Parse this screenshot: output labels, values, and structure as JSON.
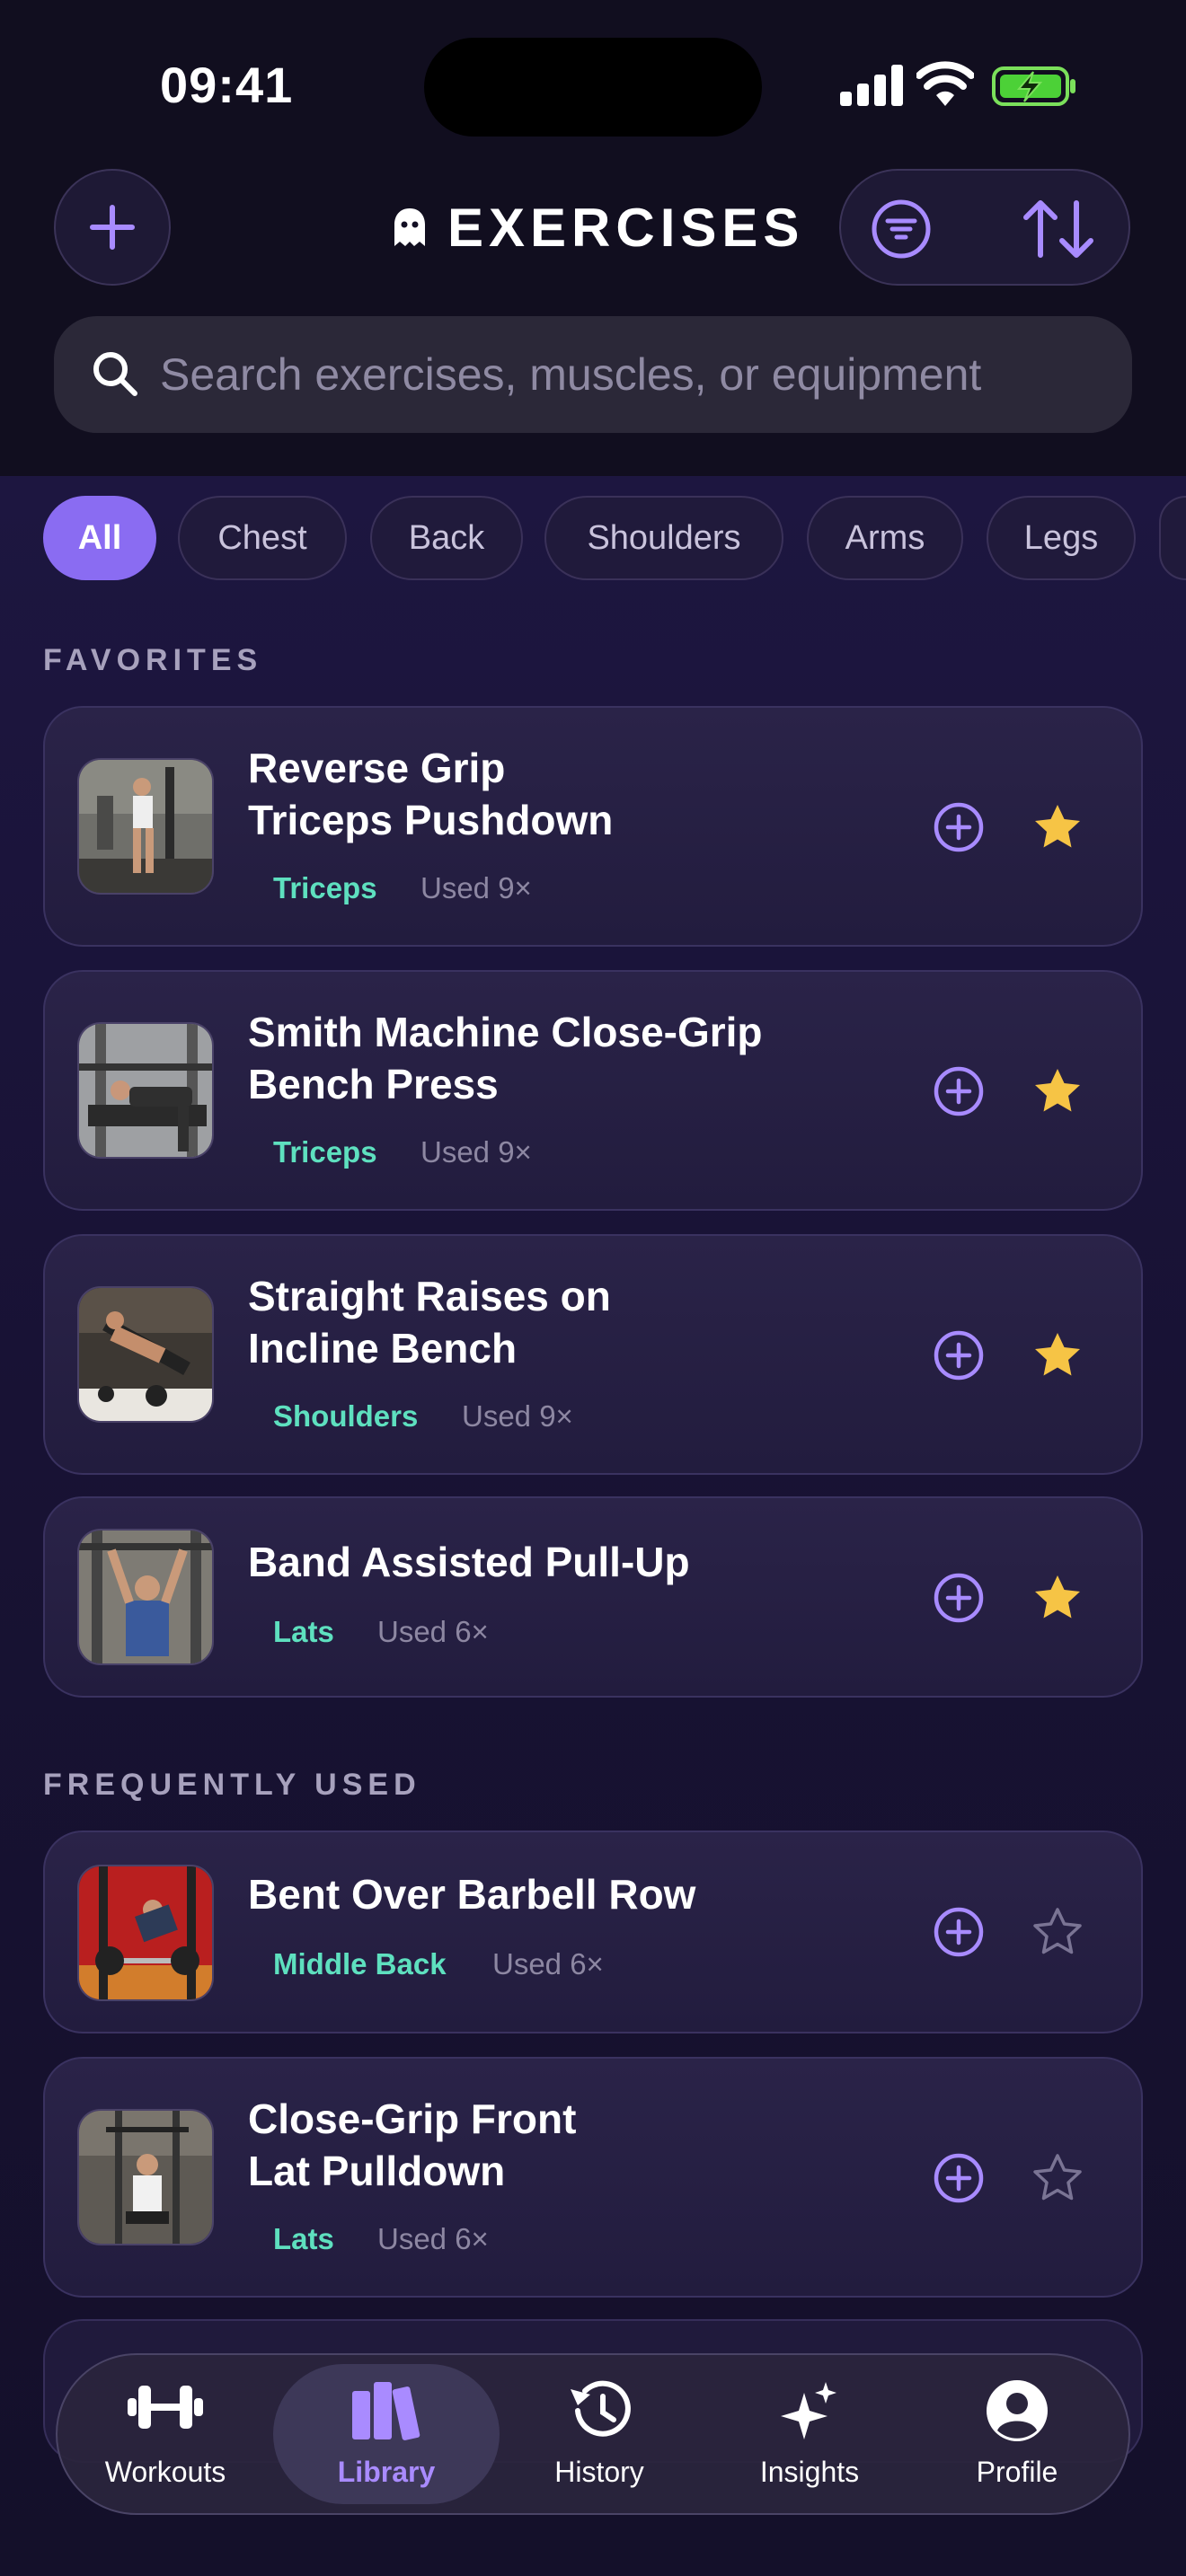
{
  "status_bar": {
    "time": "09:41"
  },
  "header": {
    "title": "EXERCISES"
  },
  "search": {
    "placeholder": "Search exercises, muscles, or equipment"
  },
  "filters": [
    "All",
    "Chest",
    "Back",
    "Shoulders",
    "Arms",
    "Legs"
  ],
  "sections": {
    "favorites": {
      "label": "FAVORITES",
      "items": [
        {
          "name_line1": "Reverse Grip",
          "name_line2": "Triceps Pushdown",
          "muscle": "Triceps",
          "used": "Used 9×",
          "favorite": true
        },
        {
          "name_line1": "Smith Machine Close-Grip",
          "name_line2": "Bench Press",
          "muscle": "Triceps",
          "used": "Used 9×",
          "favorite": true
        },
        {
          "name_line1": "Straight Raises on",
          "name_line2": "Incline Bench",
          "muscle": "Shoulders",
          "used": "Used 9×",
          "favorite": true
        },
        {
          "name_line1": "Band Assisted Pull-Up",
          "muscle": "Lats",
          "used": "Used 6×",
          "favorite": true
        }
      ]
    },
    "frequent": {
      "label": "FREQUENTLY USED",
      "items": [
        {
          "name_line1": "Bent Over Barbell Row",
          "muscle": "Middle Back",
          "used": "Used 6×",
          "favorite": false
        },
        {
          "name_line1": "Close-Grip Front",
          "name_line2": "Lat Pulldown",
          "muscle": "Lats",
          "used": "Used 6×",
          "favorite": false
        }
      ]
    }
  },
  "tabbar": {
    "tabs": [
      {
        "label": "Workouts",
        "icon": "dumbbell-icon"
      },
      {
        "label": "Library",
        "icon": "books-icon",
        "active": true
      },
      {
        "label": "History",
        "icon": "history-icon"
      },
      {
        "label": "Insights",
        "icon": "sparkles-icon"
      },
      {
        "label": "Profile",
        "icon": "person-icon"
      }
    ]
  },
  "colors": {
    "accent": "#8a6cf2",
    "muscle_tag": "#5ee0bf",
    "star": "#f6c445",
    "background": "#130f24"
  }
}
